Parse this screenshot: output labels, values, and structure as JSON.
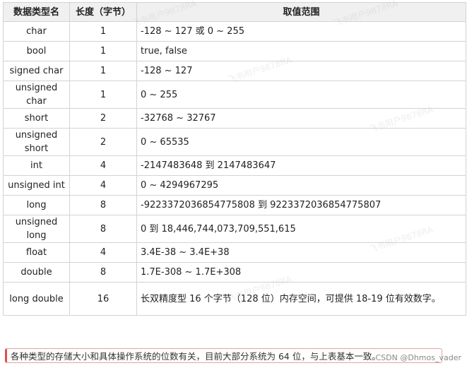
{
  "table": {
    "headers": [
      "数据类型名",
      "长度（字节）",
      "取值范围"
    ],
    "rows": [
      {
        "type": "char",
        "size": "1",
        "range": "-128 ~ 127 或 0 ~ 255"
      },
      {
        "type": "bool",
        "size": "1",
        "range": "true, false"
      },
      {
        "type": "signed char",
        "size": "1",
        "range": "-128 ~ 127"
      },
      {
        "type": "unsigned char",
        "size": "1",
        "range": "0 ~ 255"
      },
      {
        "type": "short",
        "size": "2",
        "range": "-32768 ~ 32767"
      },
      {
        "type": "unsigned short",
        "size": "2",
        "range": "0 ~ 65535"
      },
      {
        "type": "int",
        "size": "4",
        "range": "-2147483648 到 2147483647"
      },
      {
        "type": "unsigned int",
        "size": "4",
        "range": "0 ~ 4294967295"
      },
      {
        "type": "long",
        "size": "8",
        "range": "-9223372036854775808 到 9223372036854775807"
      },
      {
        "type": "unsigned long",
        "size": "8",
        "range": "0 到 18,446,744,073,709,551,615"
      },
      {
        "type": "float",
        "size": "4",
        "range": "3.4E-38 ~ 3.4E+38"
      },
      {
        "type": "double",
        "size": "8",
        "range": "1.7E-308 ~ 1.7E+308"
      },
      {
        "type": "long double",
        "size": "16",
        "range": "长双精度型 16 个字节（128 位）内存空间，可提供 18-19 位有效数字。"
      }
    ]
  },
  "note": "各种类型的存储大小和具体操作系统的位数有关，目前大部分系统为 64 位，与上表基本一致。",
  "credit": "CSDN @Dhmos_vader",
  "watermark": "飞书用户9878RA",
  "colors": {
    "header_bg": "#f0f0f0",
    "border": "#d3d3d3",
    "note_border": "#d9534f"
  }
}
